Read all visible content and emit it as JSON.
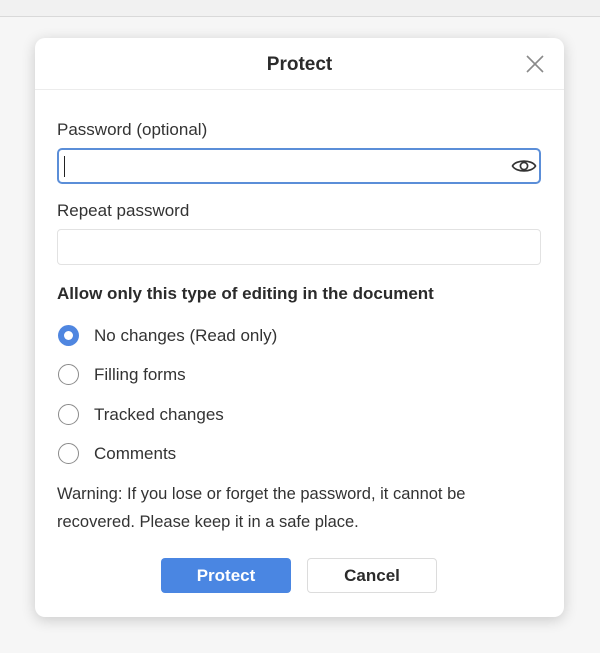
{
  "dialog": {
    "title": "Protect",
    "close_icon": "close-icon"
  },
  "password": {
    "label": "Password (optional)",
    "value": "",
    "placeholder": "",
    "toggle_icon": "eye-icon"
  },
  "repeat_password": {
    "label": "Repeat password",
    "value": "",
    "placeholder": ""
  },
  "editing": {
    "title": "Allow only this type of editing in the document",
    "options": [
      {
        "label": "No changes (Read only)",
        "selected": true
      },
      {
        "label": "Filling forms",
        "selected": false
      },
      {
        "label": "Tracked changes",
        "selected": false
      },
      {
        "label": "Comments",
        "selected": false
      }
    ]
  },
  "warning": "Warning: If you lose or forget the password, it cannot be recovered. Please keep it in a safe place.",
  "buttons": {
    "protect": "Protect",
    "cancel": "Cancel"
  },
  "colors": {
    "accent": "#4a86e2",
    "focus_border": "#5b8ed8"
  }
}
